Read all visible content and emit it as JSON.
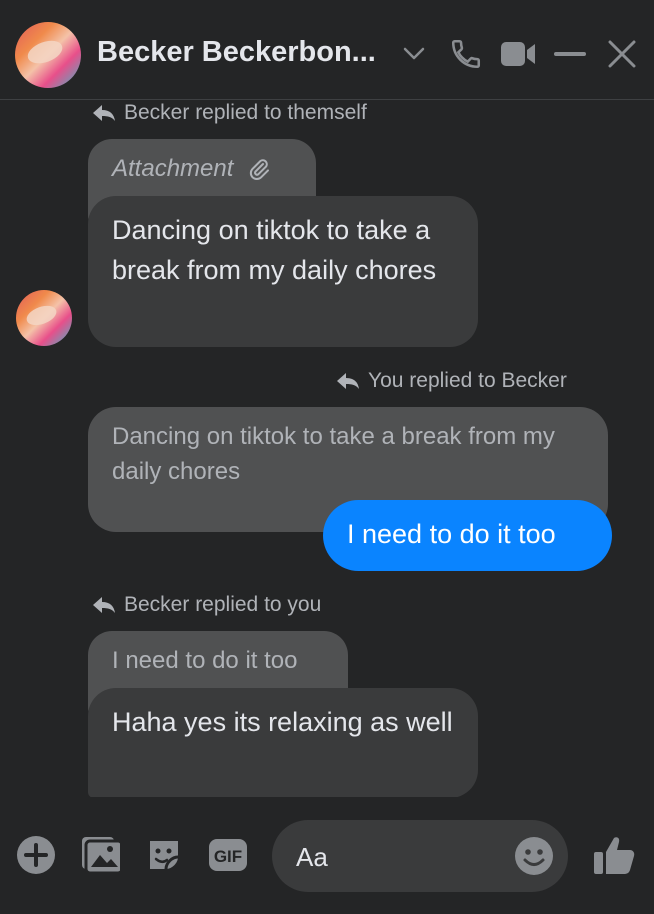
{
  "header": {
    "contact_name": "Becker Beckerbon...",
    "icons": [
      "chevron-down-icon",
      "phone-icon",
      "video-icon",
      "minimize-icon",
      "close-icon"
    ]
  },
  "colors": {
    "background": "#242526",
    "accent": "#0a84ff",
    "bubble_incoming": "#3a3b3c",
    "bubble_quoted": "#505152"
  },
  "messages": [
    {
      "reply_note": "Becker replied to themself",
      "quoted": "Attachment",
      "text": "Dancing on tiktok to take a break from my daily chores"
    },
    {
      "reply_note": "You replied to Becker",
      "quoted": "Dancing on tiktok to take a break from my daily chores",
      "text": "I need to do it too"
    },
    {
      "reply_note": "Becker replied to you",
      "quoted": "I need to do it too",
      "text": "Haha yes its relaxing as well"
    }
  ],
  "composer": {
    "placeholder": "Aa",
    "icons": [
      "add-icon",
      "photo-icon",
      "sticker-icon",
      "gif-icon",
      "emoji-icon",
      "like-icon"
    ],
    "gif_label": "GIF"
  }
}
